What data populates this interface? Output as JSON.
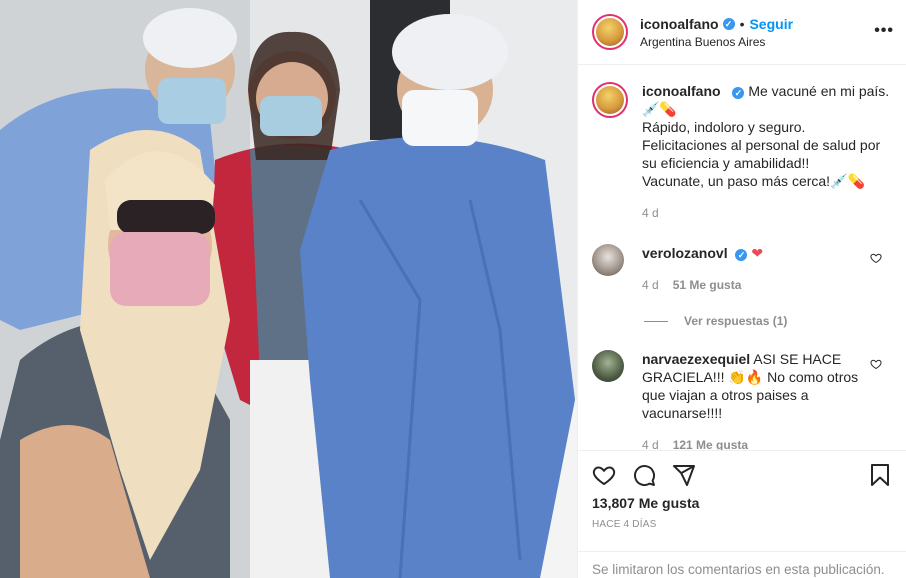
{
  "header": {
    "username": "iconoalfano",
    "follow_label": "Seguir",
    "location": "Argentina Buenos Aires",
    "more_icon": "more-horizontal-icon"
  },
  "caption": {
    "username": "iconoalfano",
    "line1": "Me vacuné en mi país.",
    "line2": "💉💊",
    "line3": "Rápido, indoloro y seguro.",
    "line4": "Felicitaciones al personal de salud por su eficiencia y amabilidad!!",
    "line5": "Vacunate, un paso más cerca!💉💊",
    "time": "4 d"
  },
  "comments": [
    {
      "username": "verolozanovl",
      "text": "❤",
      "time": "4 d",
      "likes": "51 Me gusta",
      "replies": "Ver respuestas (1)"
    },
    {
      "username": "narvaezexequiel",
      "text": "ASI SE HACE GRACIELA!!! 👏🔥 No como otros que viajan a otros paises a vacunarse!!!!",
      "time": "4 d",
      "likes": "121 Me gusta"
    }
  ],
  "footer": {
    "like_count": "13,807 Me gusta",
    "ago": "HACE 4 DÍAS",
    "limited": "Se limitaron los comentarios en esta publicación."
  },
  "colors": {
    "accent": "#0095f6",
    "verified": "#3897f0",
    "muted": "#8e8e8e",
    "heart": "#ed4956"
  }
}
